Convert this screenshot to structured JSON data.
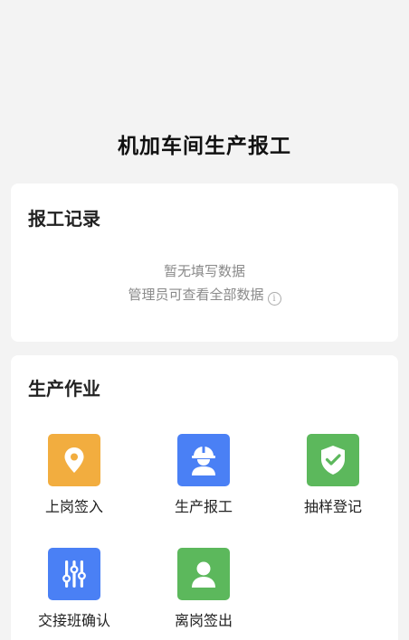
{
  "page": {
    "title": "机加车间生产报工"
  },
  "records": {
    "title": "报工记录",
    "empty_text": "暂无填写数据",
    "admin_note": "管理员可查看全部数据",
    "info_icon": "i"
  },
  "production": {
    "title": "生产作业",
    "items": [
      {
        "label": "上岗签入",
        "icon": "location-pin-icon",
        "color": "#f2ad3f"
      },
      {
        "label": "生产报工",
        "icon": "worker-helmet-icon",
        "color": "#4a80f5"
      },
      {
        "label": "抽样登记",
        "icon": "shield-check-icon",
        "color": "#5cb85c"
      },
      {
        "label": "交接班确认",
        "icon": "sliders-icon",
        "color": "#4a80f5"
      },
      {
        "label": "离岗签出",
        "icon": "person-icon",
        "color": "#5cb85c"
      }
    ]
  }
}
